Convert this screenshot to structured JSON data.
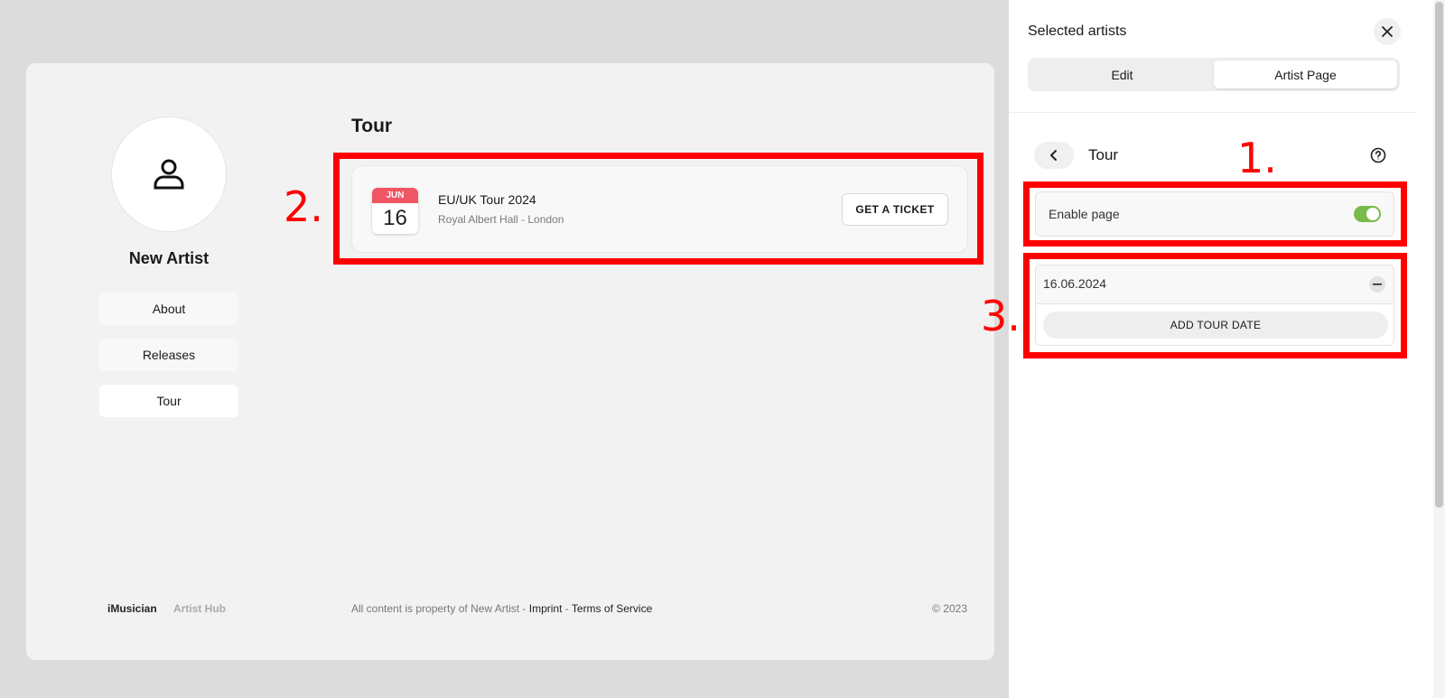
{
  "preview": {
    "artist_name": "New Artist",
    "nav": [
      "About",
      "Releases",
      "Tour"
    ],
    "section_title": "Tour",
    "event": {
      "month": "JUN",
      "day": "16",
      "title": "EU/UK Tour 2024",
      "venue": "Royal Albert Hall - London",
      "button": "GET A TICKET"
    },
    "footer": {
      "brand": "iMusician",
      "brand_sub": "Artist Hub",
      "legal_prefix": "All content is property of New Artist - ",
      "imprint": "Imprint",
      "sep": " - ",
      "terms": "Terms of Service",
      "copyright": "© 2023"
    }
  },
  "panel": {
    "title": "Selected artists",
    "tabs": [
      "Edit",
      "Artist Page"
    ],
    "active_tab": "Artist Page",
    "sub_title": "Tour",
    "enable_label": "Enable page",
    "enable_state": true,
    "dates": [
      "16.06.2024"
    ],
    "add_button": "ADD TOUR DATE"
  },
  "annotations": [
    "1.",
    "2.",
    "3."
  ],
  "colors": {
    "highlight": "#ff0000",
    "toggle_on": "#79bb4b",
    "calendar_month": "#ef5564"
  }
}
